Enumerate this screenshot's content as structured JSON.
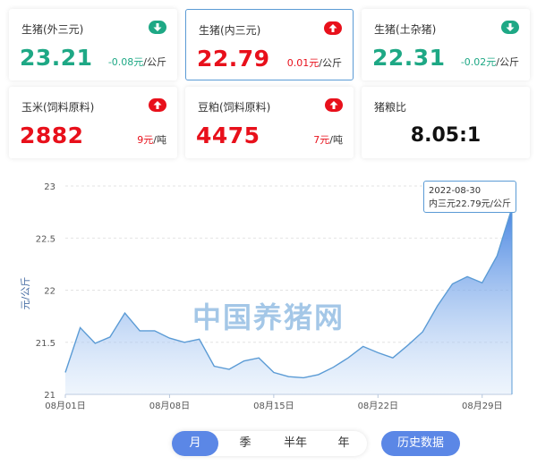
{
  "cards": [
    {
      "name": "生猪(外三元)",
      "price": "23.21",
      "change": "-0.08元",
      "unit": "/公斤",
      "direction": "down",
      "icon": "down-arrow-icon"
    },
    {
      "name": "生猪(内三元)",
      "price": "22.79",
      "change": "0.01元",
      "unit": "/公斤",
      "direction": "up",
      "icon": "up-arrow-icon"
    },
    {
      "name": "生猪(土杂猪)",
      "price": "22.31",
      "change": "-0.02元",
      "unit": "/公斤",
      "direction": "down",
      "icon": "down-arrow-icon"
    },
    {
      "name": "玉米(饲料原料)",
      "price": "2882",
      "change": "9元",
      "unit": "/吨",
      "direction": "up",
      "icon": "up-arrow-icon"
    },
    {
      "name": "豆粕(饲料原料)",
      "price": "4475",
      "change": "7元",
      "unit": "/吨",
      "direction": "up",
      "icon": "up-arrow-icon"
    },
    {
      "name": "猪粮比",
      "value": "8.05:1"
    }
  ],
  "colors": {
    "up": "#e8101b",
    "down": "#1ea885",
    "accent": "#5b87e6",
    "line": "#5b9bd5"
  },
  "watermark": "中国养猪网",
  "tooltip": {
    "date": "2022-08-30",
    "label": "内三元22.79元/公斤"
  },
  "tabs": [
    "月",
    "季",
    "半年",
    "年"
  ],
  "active_tab": "月",
  "history_button": "历史数据",
  "chart_data": {
    "type": "area",
    "title": "",
    "ylabel": "元/公斤",
    "xlabel": "",
    "ylim": [
      21,
      23
    ],
    "yticks": [
      "23",
      "22.5",
      "22",
      "21.5",
      "21"
    ],
    "xtick_labels": [
      "08月01日",
      "08月08日",
      "08月15日",
      "08月22日",
      "08月29日"
    ],
    "series": [
      {
        "values": [
          21.21,
          21.64,
          21.49,
          21.55,
          21.78,
          21.61,
          21.61,
          21.54,
          21.5,
          21.53,
          21.27,
          21.24,
          21.32,
          21.35,
          21.21,
          21.17,
          21.16,
          21.19,
          21.26,
          21.35,
          21.46,
          21.4,
          21.35,
          21.47,
          21.6,
          21.85,
          22.06,
          22.13,
          22.07,
          22.33,
          22.79
        ]
      }
    ]
  }
}
